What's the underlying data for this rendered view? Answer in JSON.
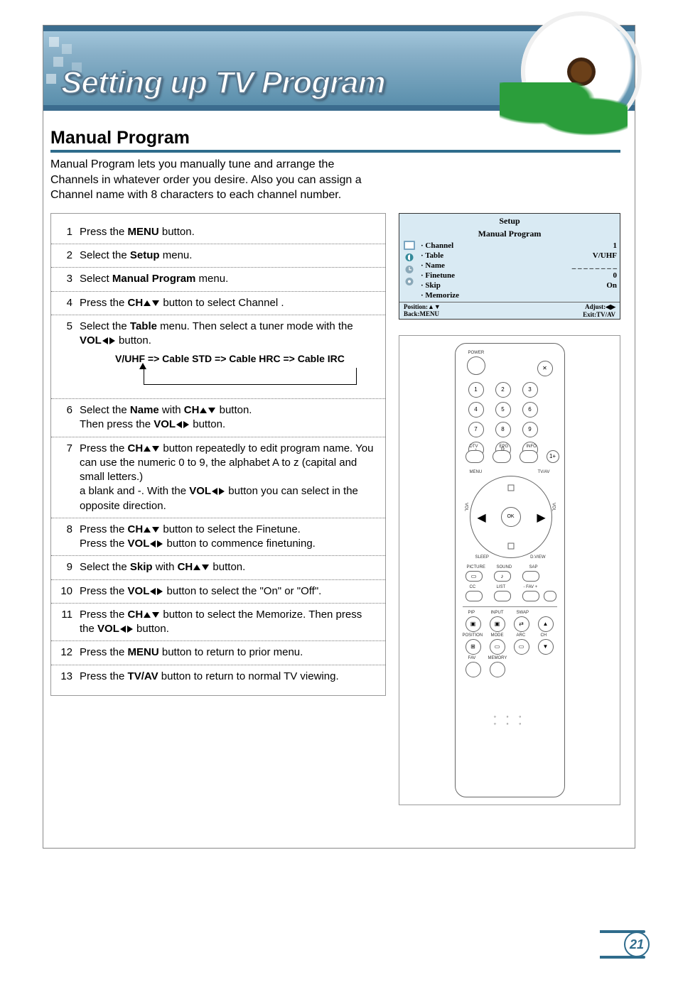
{
  "chapter_title": "Setting up TV Program",
  "section_title": "Manual Program",
  "intro": "Manual Program lets you manually tune and arrange the Channels in whatever order you desire. Also you can assign a Channel name with 8 characters to each channel number.",
  "steps": [
    {
      "n": "1",
      "text": "Press the <b>MENU</b> button."
    },
    {
      "n": "2",
      "text": "Select the <b>Setup</b> menu."
    },
    {
      "n": "3",
      "text": "Select <b>Manual Program</b> menu."
    },
    {
      "n": "4",
      "text": "Press the <b>CH</b>▲▼ button to select Channel ."
    },
    {
      "n": "5",
      "text": "Select the <b>Table</b> menu. Then select a tuner mode with the <b>VOL</b>◀▶ button."
    },
    {
      "n": "6",
      "text": "Select the <b>Name</b> with <b>CH</b>▲▼ button.<br>Then press the <b>VOL</b>◀▶ button."
    },
    {
      "n": "7",
      "text": "Press the <b>CH</b>▲▼ button repeatedly to edit program name. You can use the numeric 0 to 9, the alphabet A to z (capital and small letters.)<br>a blank and -. With the <b>VOL</b>◀▶ button you can select in the opposite direction."
    },
    {
      "n": "8",
      "text": "Press the <b>CH</b>▲▼ button to select the Finetune.<br>Press the <b>VOL</b>◀▶ button to commence finetuning."
    },
    {
      "n": "9",
      "text": "Select the <b>Skip</b> with <b>CH</b>▲▼ button."
    },
    {
      "n": "10",
      "text": "Press the <b>VOL</b>◀▶ button to select the \"On\" or \"Off\"."
    },
    {
      "n": "11",
      "text": "Press the <b>CH</b>▲▼ button to select the Memorize. Then press the <b>VOL</b>◀▶ button."
    },
    {
      "n": "12",
      "text": "Press the <b>MENU</b> button to return to prior menu."
    },
    {
      "n": "13",
      "text": "Press the <b>TV/AV</b> button to return to normal TV viewing."
    }
  ],
  "cycle_text": "V/UHF => Cable STD => Cable HRC => Cable IRC",
  "osd": {
    "title": "Setup",
    "subtitle": "Manual Program",
    "rows": [
      {
        "label": "· Channel",
        "value": "1"
      },
      {
        "label": "· Table",
        "value": "V/UHF"
      },
      {
        "label": "· Name",
        "value": "_ _ _ _ _ _ _ _"
      },
      {
        "label": "· Finetune",
        "value": "0"
      },
      {
        "label": "· Skip",
        "value": "On"
      },
      {
        "label": "· Memorize",
        "value": ""
      }
    ],
    "footer_left": "Position:▲▼\nBack:MENU",
    "footer_right": "Adjust:◀▶\nExit:TV/AV"
  },
  "remote": {
    "power": "POWER",
    "mute": "",
    "digits": [
      "1",
      "2",
      "3",
      "4",
      "5",
      "6",
      "7",
      "8",
      "9",
      "-",
      "0",
      ""
    ],
    "under_digits": [
      "DTV",
      "EPG",
      "INFO",
      "1+"
    ],
    "menu": "MENU",
    "tvav": "TV/AV",
    "ok": "OK",
    "vol_left": "VOL",
    "vol_right": "VOL",
    "bottom_labels": [
      "SLEEP",
      "D.VIEW",
      "PICTURE",
      "SOUND",
      "SAP",
      "CC",
      "LIST",
      "- FAV +"
    ],
    "pip_row": [
      "PIP",
      "INPUT",
      "SWAP",
      ""
    ],
    "pip_row2": [
      "POSITION",
      "MODE",
      "ARC",
      "CH"
    ],
    "pip_row3": [
      "FAV",
      "MEMORY",
      "",
      ""
    ]
  },
  "page_number": "21"
}
